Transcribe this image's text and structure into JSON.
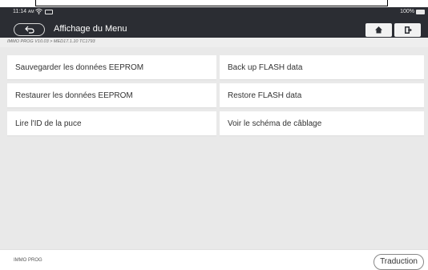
{
  "status_bar": {
    "time": "11:14",
    "ampm": "AM",
    "battery": "100%"
  },
  "header": {
    "title": "Affichage du Menu",
    "back_icon": "back-arrow-icon",
    "home_icon": "home-icon",
    "exit_icon": "exit-icon"
  },
  "breadcrumb": "IMMO PROG V10.03 > MED17.1.10 TC1793",
  "menu": {
    "items": [
      {
        "label": "Sauvegarder les données EEPROM"
      },
      {
        "label": "Back up FLASH data"
      },
      {
        "label": "Restaurer les données EEPROM"
      },
      {
        "label": "Restore FLASH data"
      },
      {
        "label": "Lire l'ID de la puce"
      },
      {
        "label": "Voir le schéma de câblage"
      }
    ]
  },
  "footer": {
    "label": "IMMO PROG",
    "translate_button": "Traduction"
  },
  "colors": {
    "header_bg": "#2b2d33",
    "content_bg": "#e9e9e9",
    "button_bg": "#f2f2f2"
  }
}
